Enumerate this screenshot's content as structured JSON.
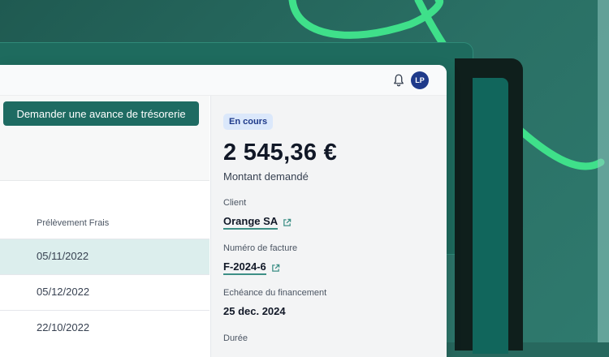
{
  "topbar": {
    "avatar_initials": "LP",
    "bell_icon": "bell-icon"
  },
  "left": {
    "cta_label": "Demander une avance de trésorerie",
    "column_header": "Prélèvement Frais",
    "rows": [
      "05/11/2022",
      "05/12/2022",
      "22/10/2022"
    ]
  },
  "detail": {
    "status_badge": "En cours",
    "amount": "2 545,36 €",
    "amount_label": "Montant demandé",
    "client_label": "Client",
    "client_value": "Orange SA",
    "invoice_label": "Numéro de facture",
    "invoice_value": "F-2024-6",
    "due_label": "Echéance du financement",
    "due_value": "25 dec. 2024",
    "duration_label": "Durée",
    "external_link_icon": "external-link-icon"
  },
  "colors": {
    "accent": "#1e6b62",
    "selected_row": "#dceeed",
    "badge_bg": "#dbe8fb",
    "avatar": "#1f3a8a"
  }
}
